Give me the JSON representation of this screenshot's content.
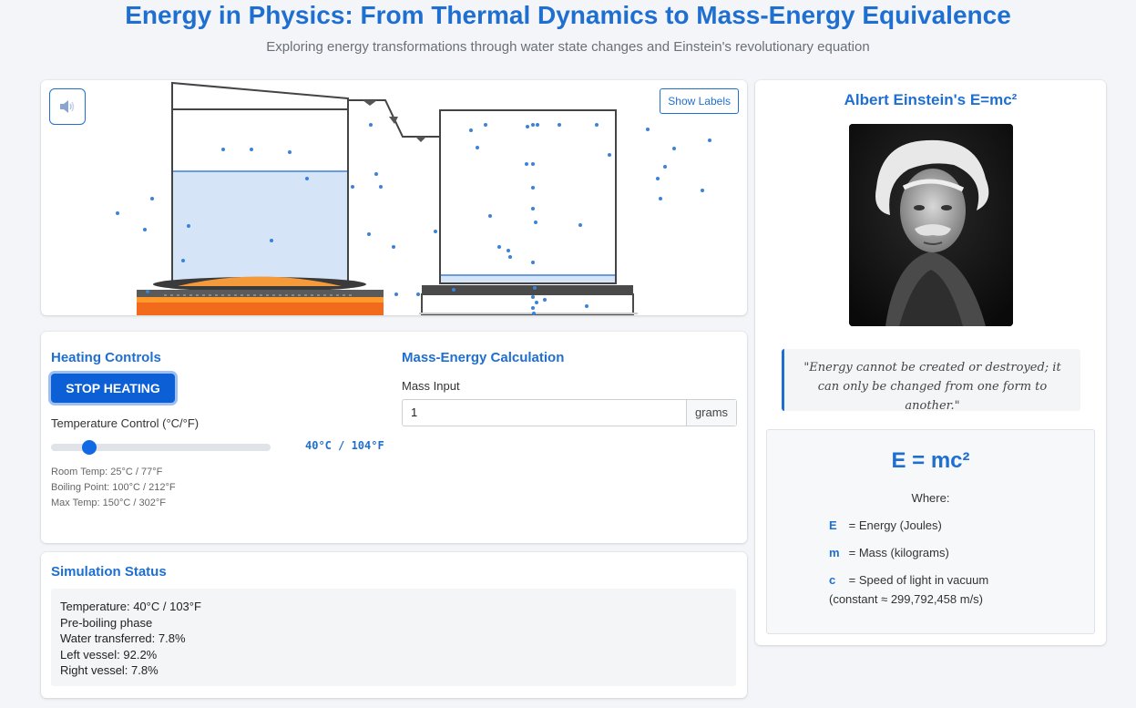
{
  "header": {
    "title": "Energy in Physics: From Thermal Dynamics to Mass-Energy Equivalence",
    "subtitle": "Exploring energy transformations through water state changes and Einstein's revolutionary equation"
  },
  "simulation": {
    "sound_icon": "speaker-icon",
    "labels_button": "Show Labels"
  },
  "heating": {
    "heading": "Heating Controls",
    "stop_button": "STOP HEATING",
    "temp_label": "Temperature Control (°C/°F)",
    "temp_readout": "40°C / 104°F",
    "slider_fraction": 0.14,
    "room_temp": "Room Temp: 25°C / 77°F",
    "boiling_point": "Boiling Point: 100°C / 212°F",
    "max_temp": "Max Temp: 150°C / 302°F"
  },
  "mass": {
    "heading": "Mass-Energy Calculation",
    "input_label": "Mass Input",
    "value": "1",
    "unit": "grams"
  },
  "status": {
    "heading": "Simulation Status",
    "lines": [
      "Temperature: 40°C / 103°F",
      "Pre-boiling phase",
      "Water transferred: 7.8%",
      "Left vessel: 92.2%",
      "Right vessel: 7.8%"
    ]
  },
  "einstein": {
    "title": "Albert Einstein's E=mc²",
    "quote": "\"Energy cannot be created or destroyed; it can only be changed from one form to another.\"",
    "formula": "E = mc²",
    "where": "Where:",
    "defs": [
      {
        "sym": "E",
        "text": "= Energy (Joules)"
      },
      {
        "sym": "m",
        "text": "= Mass (kilograms)"
      },
      {
        "sym": "c",
        "text": "= Speed of light in vacuum"
      }
    ],
    "constant": "(constant ≈ 299,792,458 m/s)"
  },
  "colors": {
    "accent": "#1f6fd1",
    "button": "#0d5fd6",
    "water": "#d6e4f7",
    "flame": "#f26a1b"
  }
}
